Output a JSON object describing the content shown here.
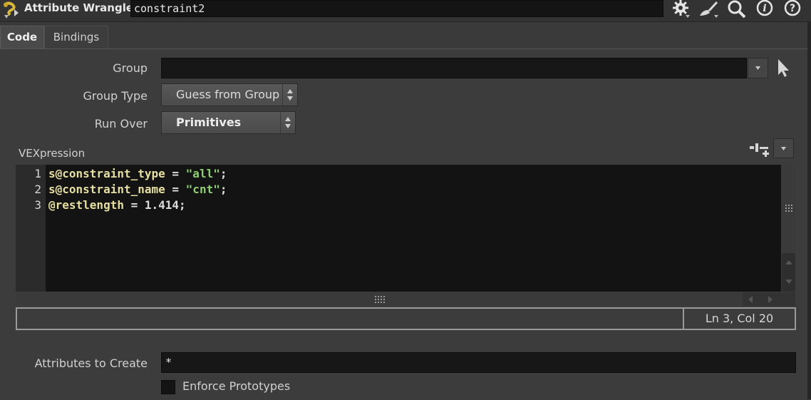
{
  "header": {
    "node_type": "Attribute Wrangle",
    "node_name": "constraint2",
    "icons": [
      "wrangle-node-icon",
      "gear-icon",
      "brush-icon",
      "search-icon",
      "info-icon",
      "help-icon"
    ]
  },
  "tabs": [
    {
      "label": "Code",
      "active": true
    },
    {
      "label": "Bindings",
      "active": false
    }
  ],
  "params": {
    "group_label": "Group",
    "group_value": "",
    "group_type_label": "Group Type",
    "group_type_value": "Guess from Group",
    "run_over_label": "Run Over",
    "run_over_value": "Primitives",
    "vex_label": "VEXpression",
    "attrs_label": "Attributes to Create",
    "attrs_value": "*",
    "enforce_label": "Enforce Prototypes",
    "enforce_checked": false
  },
  "editor": {
    "line_numbers": [
      "1",
      "2",
      "3"
    ],
    "lines": [
      {
        "var": "s@constraint_type",
        "op": " = ",
        "lit": "\"all\"",
        "end": ";"
      },
      {
        "var": "s@constraint_name",
        "op": " = ",
        "lit": "\"cnt\"",
        "end": ";"
      },
      {
        "var": "@restlength",
        "op": " = ",
        "lit": "1.414",
        "end": ";"
      }
    ],
    "status": "Ln 3, Col 20"
  },
  "colors": {
    "background": "#3a3a3a",
    "editor_bg": "#131313",
    "variable": "#e6dfa2",
    "string": "#8fce72"
  }
}
